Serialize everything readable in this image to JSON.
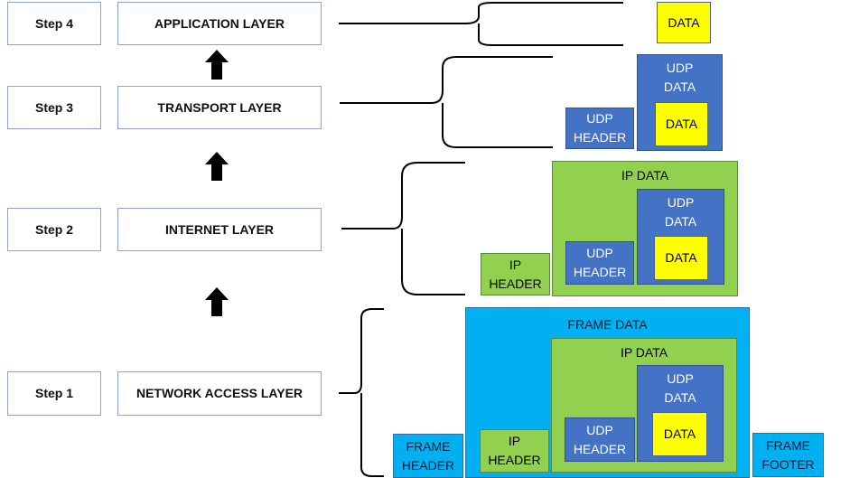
{
  "steps": [
    "Step 4",
    "Step 3",
    "Step 2",
    "Step 1"
  ],
  "layers": [
    "APPLICATION LAYER",
    "TRANSPORT LAYER",
    "INTERNET LAYER",
    "NETWORK ACCESS LAYER"
  ],
  "labels": {
    "data": "DATA",
    "udp_data": "UDP DATA",
    "udp_header": "UDP HEADER",
    "ip_data": "IP DATA",
    "ip_header": "IP HEADER",
    "frame_data": "FRAME DATA",
    "frame_header": "FRAME HEADER",
    "frame_footer": "FRAME FOOTER"
  },
  "colors": {
    "data": "#FFFF00",
    "udp": "#4472C4",
    "ip": "#92D050",
    "frame": "#00B0F0"
  }
}
